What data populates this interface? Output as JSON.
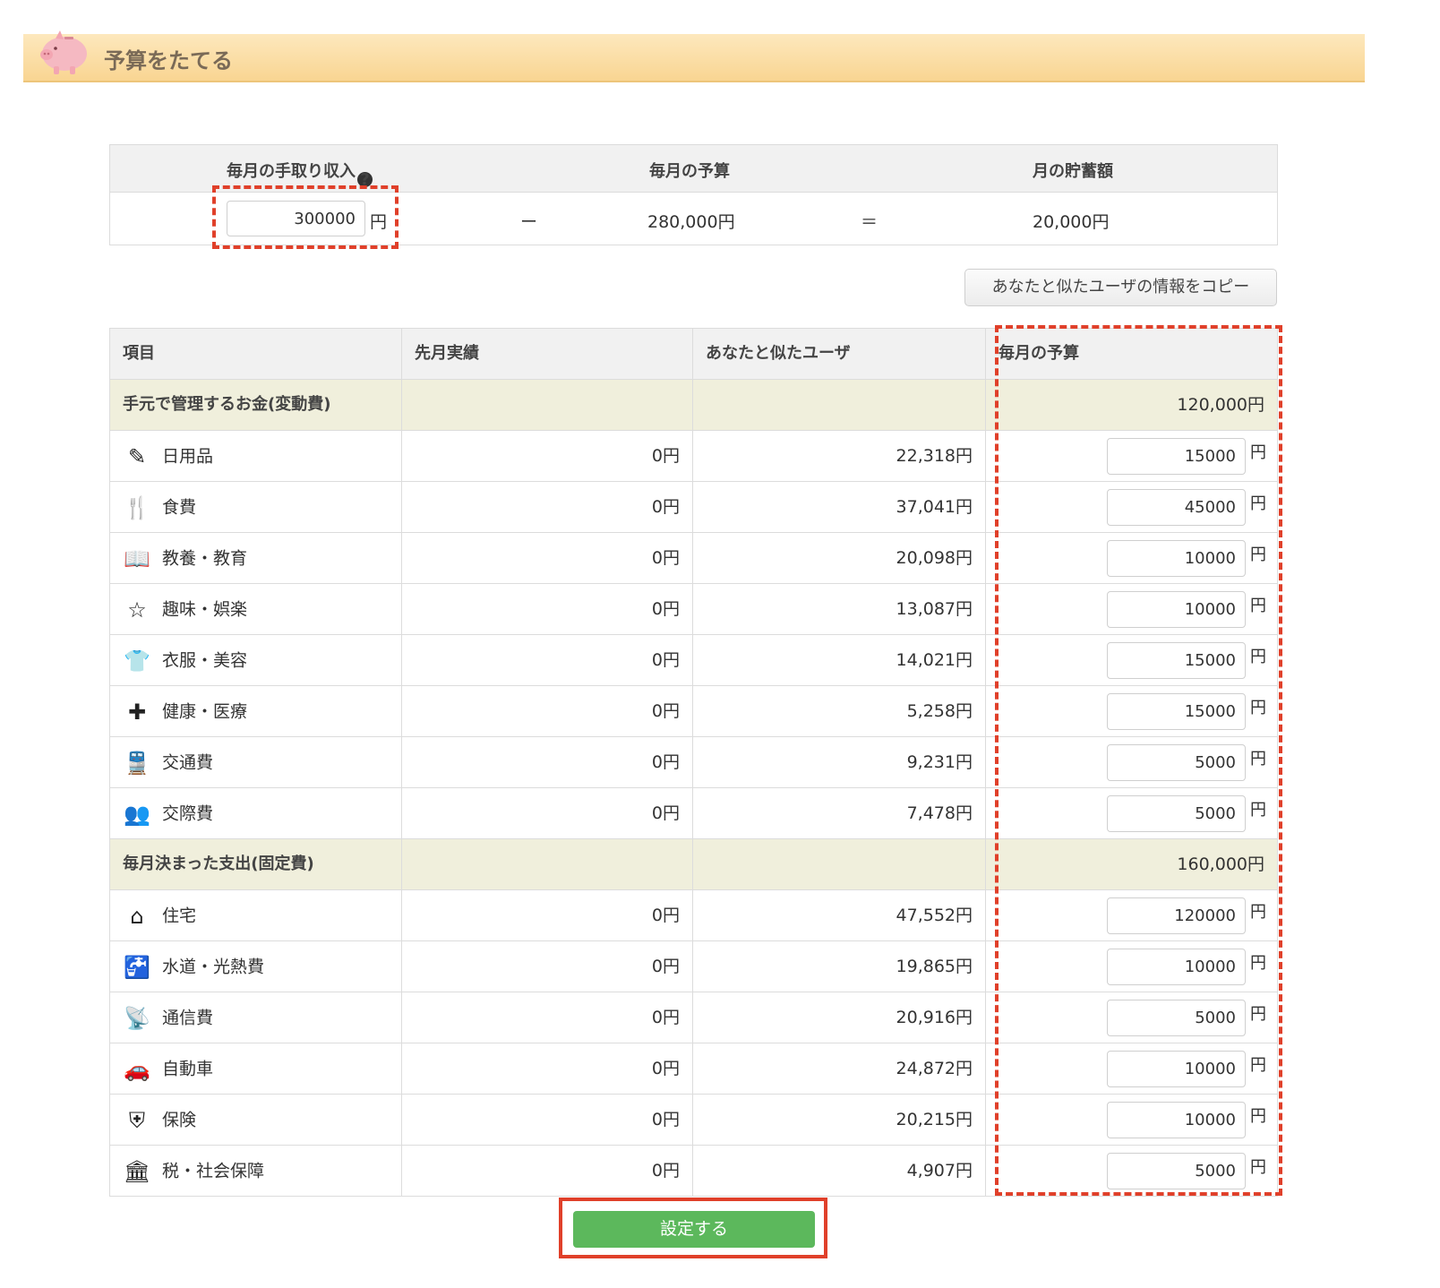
{
  "header": {
    "title": "予算をたてる"
  },
  "summary": {
    "income_label": "毎月の手取り収入",
    "budget_label": "毎月の予算",
    "savings_label": "月の貯蓄額",
    "income_value": "300000",
    "yen": "円",
    "minus": "ー",
    "budget_total": "280,000円",
    "equals": "＝",
    "savings_value": "20,000円"
  },
  "copy_button": "あなたと似たユーザの情報をコピー",
  "table": {
    "headers": [
      "項目",
      "先月実績",
      "あなたと似たユーザ",
      "毎月の予算"
    ],
    "sections": [
      {
        "title": "手元で管理するお金(変動費)",
        "total": "120,000円",
        "rows": [
          {
            "icon": "toothbrush-icon",
            "glyph": "✎",
            "label": "日用品",
            "last": "0円",
            "similar": "22,318円",
            "budget": "15000"
          },
          {
            "icon": "fork-spoon-icon",
            "glyph": "🍴",
            "label": "食費",
            "last": "0円",
            "similar": "37,041円",
            "budget": "45000"
          },
          {
            "icon": "book-icon",
            "glyph": "📖",
            "label": "教養・教育",
            "last": "0円",
            "similar": "20,098円",
            "budget": "10000"
          },
          {
            "icon": "star-icon",
            "glyph": "☆",
            "label": "趣味・娯楽",
            "last": "0円",
            "similar": "13,087円",
            "budget": "10000"
          },
          {
            "icon": "tshirt-icon",
            "glyph": "👕",
            "label": "衣服・美容",
            "last": "0円",
            "similar": "14,021円",
            "budget": "15000"
          },
          {
            "icon": "medical-cross-icon",
            "glyph": "✚",
            "label": "健康・医療",
            "last": "0円",
            "similar": "5,258円",
            "budget": "15000"
          },
          {
            "icon": "train-icon",
            "glyph": "🚆",
            "label": "交通費",
            "last": "0円",
            "similar": "9,231円",
            "budget": "5000"
          },
          {
            "icon": "people-icon",
            "glyph": "👥",
            "label": "交際費",
            "last": "0円",
            "similar": "7,478円",
            "budget": "5000"
          }
        ]
      },
      {
        "title": "毎月決まった支出(固定費)",
        "total": "160,000円",
        "rows": [
          {
            "icon": "house-icon",
            "glyph": "⌂",
            "label": "住宅",
            "last": "0円",
            "similar": "47,552円",
            "budget": "120000"
          },
          {
            "icon": "faucet-icon",
            "glyph": "🚰",
            "label": "水道・光熱費",
            "last": "0円",
            "similar": "19,865円",
            "budget": "10000"
          },
          {
            "icon": "antenna-icon",
            "glyph": "📡",
            "label": "通信費",
            "last": "0円",
            "similar": "20,916円",
            "budget": "5000"
          },
          {
            "icon": "car-icon",
            "glyph": "🚗",
            "label": "自動車",
            "last": "0円",
            "similar": "24,872円",
            "budget": "10000"
          },
          {
            "icon": "shield-icon",
            "glyph": "⛨",
            "label": "保険",
            "last": "0円",
            "similar": "20,215円",
            "budget": "10000"
          },
          {
            "icon": "pillar-icon",
            "glyph": "🏛",
            "label": "税・社会保障",
            "last": "0円",
            "similar": "4,907円",
            "budget": "5000"
          }
        ]
      }
    ]
  },
  "submit_button": "設定する"
}
